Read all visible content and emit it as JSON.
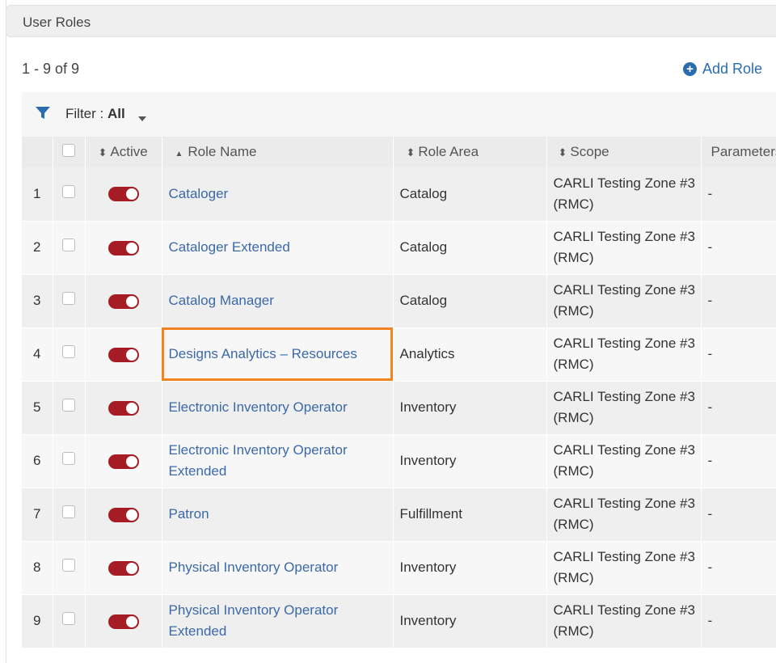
{
  "section": {
    "title": "User Roles"
  },
  "summary": {
    "count": "1 - 9 of 9"
  },
  "actions": {
    "add_role_label": "Add Role"
  },
  "filter": {
    "label": "Filter :",
    "value": "All"
  },
  "columns": {
    "active": "Active",
    "role_name": "Role Name",
    "role_area": "Role Area",
    "scope": "Scope",
    "parameters": "Parameters"
  },
  "rows": [
    {
      "num": "1",
      "name": "Cataloger",
      "area": "Catalog",
      "scope": "CARLI Testing Zone #3 (RMC)",
      "params": "-",
      "active": true
    },
    {
      "num": "2",
      "name": "Cataloger Extended",
      "area": "Catalog",
      "scope": "CARLI Testing Zone #3 (RMC)",
      "params": "-",
      "active": true
    },
    {
      "num": "3",
      "name": "Catalog Manager",
      "area": "Catalog",
      "scope": "CARLI Testing Zone #3 (RMC)",
      "params": "-",
      "active": true
    },
    {
      "num": "4",
      "name": "Designs Analytics – Resources",
      "area": "Analytics",
      "scope": "CARLI Testing Zone #3 (RMC)",
      "params": "-",
      "active": true,
      "highlighted": true
    },
    {
      "num": "5",
      "name": "Electronic Inventory Operator",
      "area": "Inventory",
      "scope": "CARLI Testing Zone #3 (RMC)",
      "params": "-",
      "active": true
    },
    {
      "num": "6",
      "name": "Electronic Inventory Operator Extended",
      "area": "Inventory",
      "scope": "CARLI Testing Zone #3 (RMC)",
      "params": "-",
      "active": true
    },
    {
      "num": "7",
      "name": "Patron",
      "area": "Fulfillment",
      "scope": "CARLI Testing Zone #3 (RMC)",
      "params": "-",
      "active": true
    },
    {
      "num": "8",
      "name": "Physical Inventory Operator",
      "area": "Inventory",
      "scope": "CARLI Testing Zone #3 (RMC)",
      "params": "-",
      "active": true
    },
    {
      "num": "9",
      "name": "Physical Inventory Operator Extended",
      "area": "Inventory",
      "scope": "CARLI Testing Zone #3 (RMC)",
      "params": "-",
      "active": true
    }
  ],
  "colors": {
    "link": "#3b69a8",
    "toggle_on": "#a51c24",
    "highlight_border": "#f58220",
    "accent": "#2b6cb0"
  }
}
